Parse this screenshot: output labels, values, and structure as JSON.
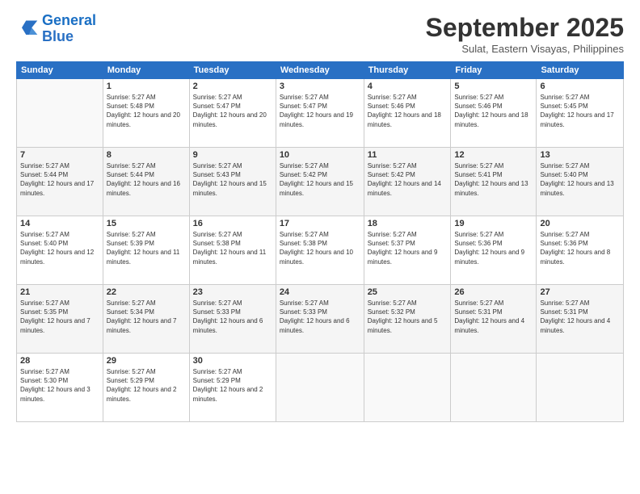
{
  "logo": {
    "line1": "General",
    "line2": "Blue"
  },
  "title": "September 2025",
  "location": "Sulat, Eastern Visayas, Philippines",
  "weekdays": [
    "Sunday",
    "Monday",
    "Tuesday",
    "Wednesday",
    "Thursday",
    "Friday",
    "Saturday"
  ],
  "weeks": [
    [
      {
        "day": "",
        "sunrise": "",
        "sunset": "",
        "daylight": ""
      },
      {
        "day": "1",
        "sunrise": "Sunrise: 5:27 AM",
        "sunset": "Sunset: 5:48 PM",
        "daylight": "Daylight: 12 hours and 20 minutes."
      },
      {
        "day": "2",
        "sunrise": "Sunrise: 5:27 AM",
        "sunset": "Sunset: 5:47 PM",
        "daylight": "Daylight: 12 hours and 20 minutes."
      },
      {
        "day": "3",
        "sunrise": "Sunrise: 5:27 AM",
        "sunset": "Sunset: 5:47 PM",
        "daylight": "Daylight: 12 hours and 19 minutes."
      },
      {
        "day": "4",
        "sunrise": "Sunrise: 5:27 AM",
        "sunset": "Sunset: 5:46 PM",
        "daylight": "Daylight: 12 hours and 18 minutes."
      },
      {
        "day": "5",
        "sunrise": "Sunrise: 5:27 AM",
        "sunset": "Sunset: 5:46 PM",
        "daylight": "Daylight: 12 hours and 18 minutes."
      },
      {
        "day": "6",
        "sunrise": "Sunrise: 5:27 AM",
        "sunset": "Sunset: 5:45 PM",
        "daylight": "Daylight: 12 hours and 17 minutes."
      }
    ],
    [
      {
        "day": "7",
        "sunrise": "Sunrise: 5:27 AM",
        "sunset": "Sunset: 5:44 PM",
        "daylight": "Daylight: 12 hours and 17 minutes."
      },
      {
        "day": "8",
        "sunrise": "Sunrise: 5:27 AM",
        "sunset": "Sunset: 5:44 PM",
        "daylight": "Daylight: 12 hours and 16 minutes."
      },
      {
        "day": "9",
        "sunrise": "Sunrise: 5:27 AM",
        "sunset": "Sunset: 5:43 PM",
        "daylight": "Daylight: 12 hours and 15 minutes."
      },
      {
        "day": "10",
        "sunrise": "Sunrise: 5:27 AM",
        "sunset": "Sunset: 5:42 PM",
        "daylight": "Daylight: 12 hours and 15 minutes."
      },
      {
        "day": "11",
        "sunrise": "Sunrise: 5:27 AM",
        "sunset": "Sunset: 5:42 PM",
        "daylight": "Daylight: 12 hours and 14 minutes."
      },
      {
        "day": "12",
        "sunrise": "Sunrise: 5:27 AM",
        "sunset": "Sunset: 5:41 PM",
        "daylight": "Daylight: 12 hours and 13 minutes."
      },
      {
        "day": "13",
        "sunrise": "Sunrise: 5:27 AM",
        "sunset": "Sunset: 5:40 PM",
        "daylight": "Daylight: 12 hours and 13 minutes."
      }
    ],
    [
      {
        "day": "14",
        "sunrise": "Sunrise: 5:27 AM",
        "sunset": "Sunset: 5:40 PM",
        "daylight": "Daylight: 12 hours and 12 minutes."
      },
      {
        "day": "15",
        "sunrise": "Sunrise: 5:27 AM",
        "sunset": "Sunset: 5:39 PM",
        "daylight": "Daylight: 12 hours and 11 minutes."
      },
      {
        "day": "16",
        "sunrise": "Sunrise: 5:27 AM",
        "sunset": "Sunset: 5:38 PM",
        "daylight": "Daylight: 12 hours and 11 minutes."
      },
      {
        "day": "17",
        "sunrise": "Sunrise: 5:27 AM",
        "sunset": "Sunset: 5:38 PM",
        "daylight": "Daylight: 12 hours and 10 minutes."
      },
      {
        "day": "18",
        "sunrise": "Sunrise: 5:27 AM",
        "sunset": "Sunset: 5:37 PM",
        "daylight": "Daylight: 12 hours and 9 minutes."
      },
      {
        "day": "19",
        "sunrise": "Sunrise: 5:27 AM",
        "sunset": "Sunset: 5:36 PM",
        "daylight": "Daylight: 12 hours and 9 minutes."
      },
      {
        "day": "20",
        "sunrise": "Sunrise: 5:27 AM",
        "sunset": "Sunset: 5:36 PM",
        "daylight": "Daylight: 12 hours and 8 minutes."
      }
    ],
    [
      {
        "day": "21",
        "sunrise": "Sunrise: 5:27 AM",
        "sunset": "Sunset: 5:35 PM",
        "daylight": "Daylight: 12 hours and 7 minutes."
      },
      {
        "day": "22",
        "sunrise": "Sunrise: 5:27 AM",
        "sunset": "Sunset: 5:34 PM",
        "daylight": "Daylight: 12 hours and 7 minutes."
      },
      {
        "day": "23",
        "sunrise": "Sunrise: 5:27 AM",
        "sunset": "Sunset: 5:33 PM",
        "daylight": "Daylight: 12 hours and 6 minutes."
      },
      {
        "day": "24",
        "sunrise": "Sunrise: 5:27 AM",
        "sunset": "Sunset: 5:33 PM",
        "daylight": "Daylight: 12 hours and 6 minutes."
      },
      {
        "day": "25",
        "sunrise": "Sunrise: 5:27 AM",
        "sunset": "Sunset: 5:32 PM",
        "daylight": "Daylight: 12 hours and 5 minutes."
      },
      {
        "day": "26",
        "sunrise": "Sunrise: 5:27 AM",
        "sunset": "Sunset: 5:31 PM",
        "daylight": "Daylight: 12 hours and 4 minutes."
      },
      {
        "day": "27",
        "sunrise": "Sunrise: 5:27 AM",
        "sunset": "Sunset: 5:31 PM",
        "daylight": "Daylight: 12 hours and 4 minutes."
      }
    ],
    [
      {
        "day": "28",
        "sunrise": "Sunrise: 5:27 AM",
        "sunset": "Sunset: 5:30 PM",
        "daylight": "Daylight: 12 hours and 3 minutes."
      },
      {
        "day": "29",
        "sunrise": "Sunrise: 5:27 AM",
        "sunset": "Sunset: 5:29 PM",
        "daylight": "Daylight: 12 hours and 2 minutes."
      },
      {
        "day": "30",
        "sunrise": "Sunrise: 5:27 AM",
        "sunset": "Sunset: 5:29 PM",
        "daylight": "Daylight: 12 hours and 2 minutes."
      },
      {
        "day": "",
        "sunrise": "",
        "sunset": "",
        "daylight": ""
      },
      {
        "day": "",
        "sunrise": "",
        "sunset": "",
        "daylight": ""
      },
      {
        "day": "",
        "sunrise": "",
        "sunset": "",
        "daylight": ""
      },
      {
        "day": "",
        "sunrise": "",
        "sunset": "",
        "daylight": ""
      }
    ]
  ]
}
